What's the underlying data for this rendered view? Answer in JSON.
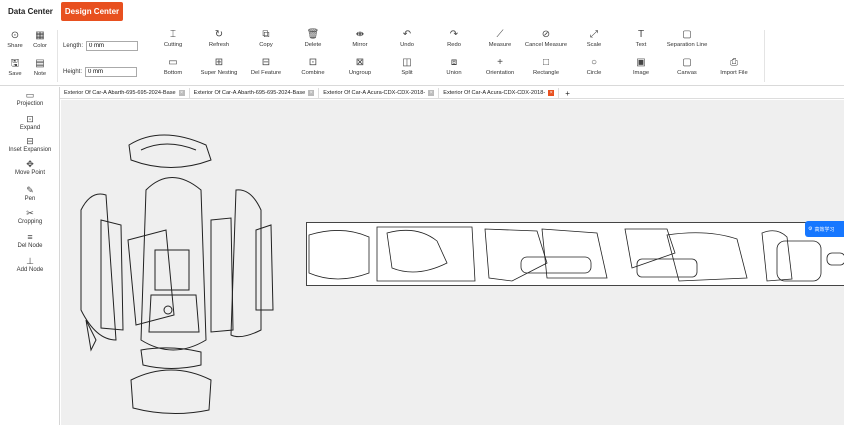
{
  "nav": {
    "data_center": "Data Center",
    "design_center": "Design Center"
  },
  "toolbar": {
    "share": "Share",
    "color": "Color",
    "save": "Save",
    "note": "Note",
    "length_label": "Length:",
    "length_value": "0 mm",
    "height_label": "Height:",
    "height_value": "0 mm",
    "row1": [
      "Cutting",
      "Refresh",
      "Copy",
      "Delete",
      "Mirror",
      "Undo",
      "Redo",
      "Measure",
      "Cancel Measure",
      "Scale",
      "Text",
      "Separation Line"
    ],
    "row2": [
      "Bottom",
      "Super Nesting",
      "Del Feature",
      "Combine",
      "Ungroup",
      "Split",
      "Union",
      "Orientation",
      "Rectangle",
      "Circle",
      "Image",
      "Canvas",
      "Import File"
    ]
  },
  "sidebar": [
    "Projection",
    "Expand",
    "Inset Expansion",
    "Move Point",
    "Pen",
    "Cropping",
    "Del Node",
    "Add Node"
  ],
  "tabs": [
    "Exterior Of Car-A Abarth-695-695-2024-Base",
    "Exterior Of Car-A Abarth-695-695-2024-Base",
    "Exterior Of Car-A Acura-CDX-CDX-2018-",
    "Exterior Of Car-A Acura-CDX-CDX-2018-"
  ],
  "add_tab": "+",
  "float_button": "高效学习"
}
